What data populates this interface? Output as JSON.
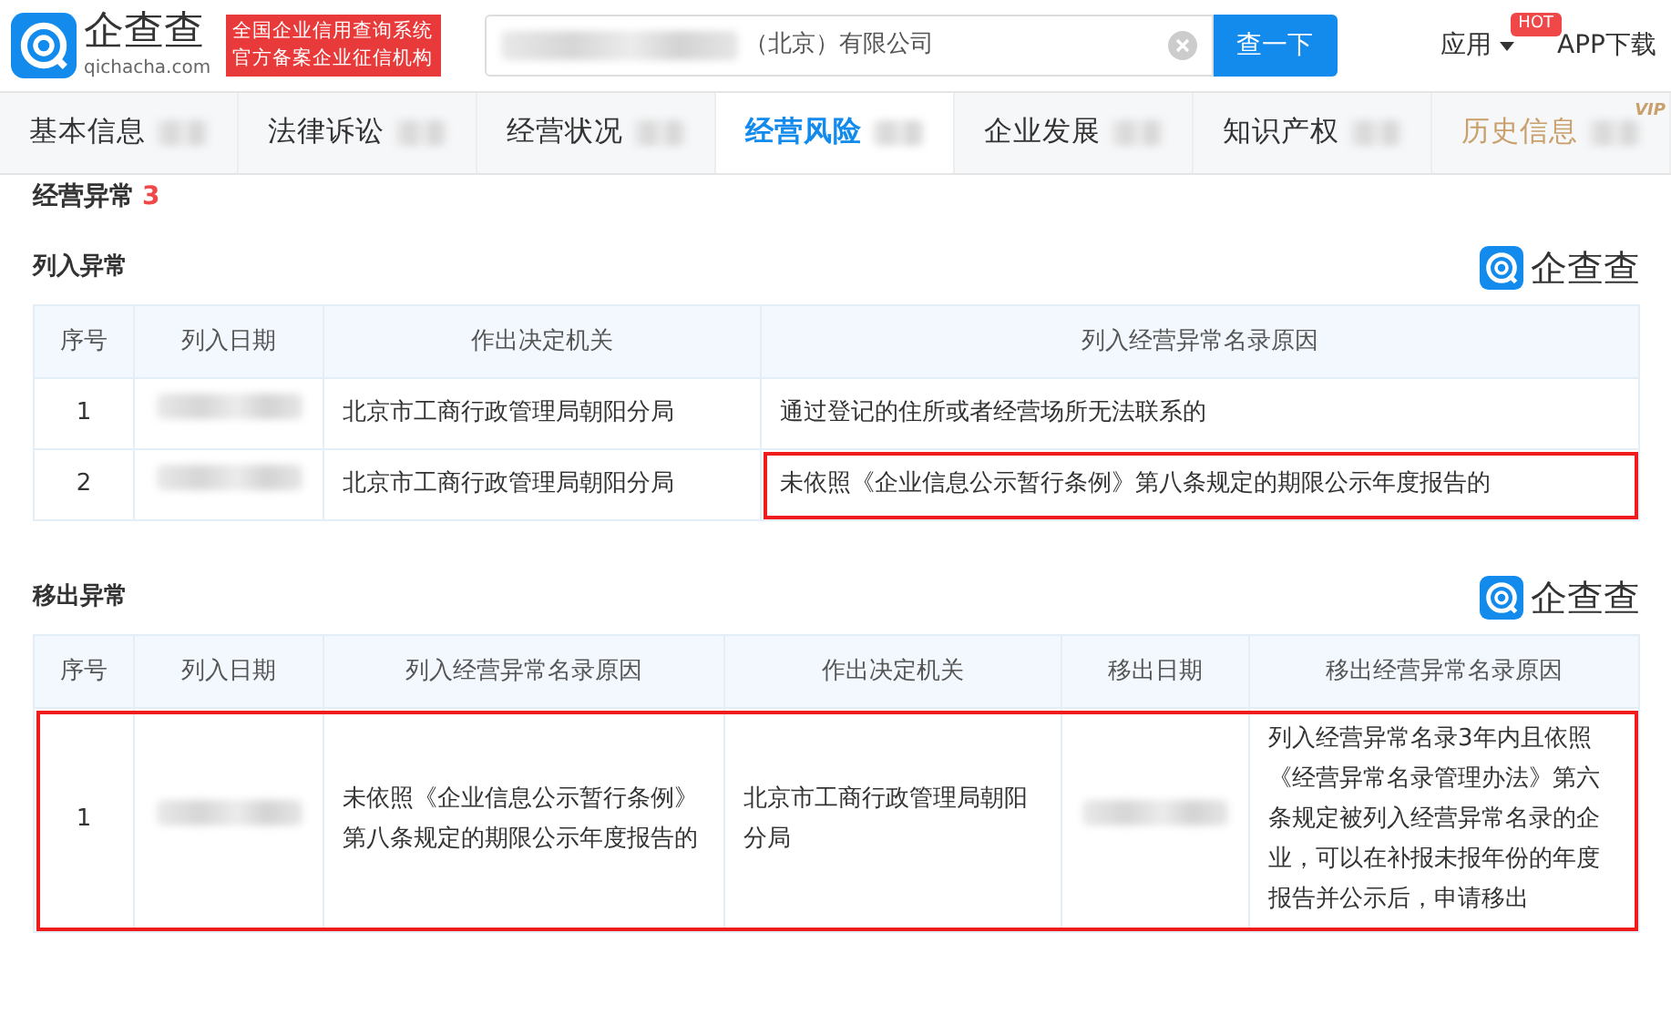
{
  "header": {
    "logo": {
      "name": "企查查",
      "domain": "qichacha.com"
    },
    "slogan": [
      "全国企业信用查询系统",
      "官方备案企业征信机构"
    ],
    "search": {
      "value": "（北京）有限公司",
      "button": "查一下"
    },
    "menu": {
      "label": "应用",
      "badge": "HOT"
    },
    "app_link": "APP下载"
  },
  "tabs": [
    {
      "label": "基本信息",
      "selected": false,
      "kind": "normal"
    },
    {
      "label": "法律诉讼",
      "selected": false,
      "kind": "normal"
    },
    {
      "label": "经营状况",
      "selected": false,
      "kind": "normal"
    },
    {
      "label": "经营风险",
      "selected": true,
      "kind": "normal"
    },
    {
      "label": "企业发展",
      "selected": false,
      "kind": "normal"
    },
    {
      "label": "知识产权",
      "selected": false,
      "kind": "normal"
    },
    {
      "label": "历史信息",
      "selected": false,
      "kind": "vip",
      "badge": "VIP"
    }
  ],
  "section": {
    "title": "经营异常",
    "count": "3"
  },
  "listed": {
    "title": "列入异常",
    "brand": "企查查",
    "columns": [
      "序号",
      "列入日期",
      "作出决定机关",
      "列入经营异常名录原因"
    ],
    "rows": [
      {
        "index": "1",
        "authority": "北京市工商行政管理局朝阳分局",
        "reason": "通过登记的住所或者经营场所无法联系的",
        "highlighted": false
      },
      {
        "index": "2",
        "authority": "北京市工商行政管理局朝阳分局",
        "reason": "未依照《企业信息公示暂行条例》第八条规定的期限公示年度报告的",
        "highlighted": true
      }
    ]
  },
  "removed": {
    "title": "移出异常",
    "brand": "企查查",
    "columns": [
      "序号",
      "列入日期",
      "列入经营异常名录原因",
      "作出决定机关",
      "移出日期",
      "移出经营异常名录原因"
    ],
    "rows": [
      {
        "index": "1",
        "list_reason": "未依照《企业信息公示暂行条例》第八条规定的期限公示年度报告的",
        "authority": "北京市工商行政管理局朝阳分局",
        "removal_reason": "列入经营异常名录3年内且依照《经营异常名录管理办法》第六条规定被列入经营异常名录的企业，可以在补报未报年份的年度报告并公示后，申请移出",
        "highlighted": true
      }
    ]
  }
}
